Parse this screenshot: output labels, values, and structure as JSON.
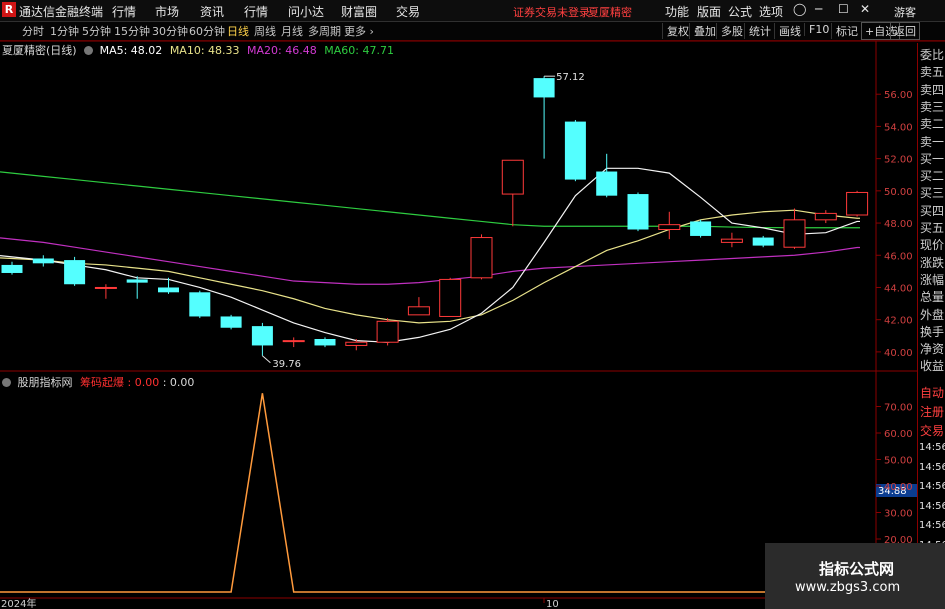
{
  "menubar": {
    "logo": "R",
    "app_title": "通达信金融终端",
    "items": [
      "行情",
      "市场",
      "资讯",
      "行情",
      "问小达",
      "财富圈",
      "交易"
    ],
    "notice": "证券交易未登录",
    "account": "夏厦精密",
    "right_items": [
      "功能",
      "版面",
      "公式",
      "选项"
    ],
    "guest": "游客"
  },
  "toolbar": {
    "periods": [
      "分时",
      "1分钟",
      "5分钟",
      "15分钟",
      "30分钟",
      "60分钟",
      "日线",
      "周线",
      "月线",
      "多周期",
      "更多"
    ],
    "active_period": "日线",
    "buttons": [
      "复权",
      "叠加",
      "多股",
      "统计",
      "画线",
      "F10",
      "标记",
      "+自选",
      "返回"
    ]
  },
  "main_chart": {
    "title": "夏厦精密(日线)",
    "ma": [
      {
        "label": "MA5: 48.02",
        "color": "#ffffff"
      },
      {
        "label": "MA10: 48.33",
        "color": "#e8e28a"
      },
      {
        "label": "MA20: 46.48",
        "color": "#d43ad4"
      },
      {
        "label": "MA60: 47.71",
        "color": "#2ecc40"
      }
    ],
    "high_label": "57.12",
    "low_label": "39.76",
    "y_ticks": [
      "56.00",
      "54.00",
      "52.00",
      "50.00",
      "48.00",
      "46.00",
      "44.00",
      "42.00",
      "40.00"
    ]
  },
  "sub_chart": {
    "title": "股朋指标网",
    "indicator_name": "筹码起爆",
    "v1": ": 0.00",
    "v2": ": 0.00",
    "y_ticks": [
      "70.00",
      "60.00",
      "50.00",
      "40.00",
      "30.00",
      "20.00"
    ],
    "current_value": "34.88"
  },
  "x_axis": {
    "year": "2024年",
    "mark": "10"
  },
  "right_panel": {
    "labels": [
      "委比",
      "卖五",
      "卖四",
      "卖三",
      "卖二",
      "卖一",
      "买一",
      "买二",
      "买三",
      "买四",
      "买五",
      "现价",
      "涨跌",
      "涨幅",
      "总量",
      "外盘",
      "换手",
      "净资",
      "收益"
    ],
    "red_labels": [
      "自动",
      "注册",
      "交易"
    ],
    "times": [
      "14:56",
      "14:56",
      "14:56",
      "14:56",
      "14:56",
      "14:56",
      "14:56",
      "14:56"
    ]
  },
  "chart_data": {
    "type": "candlestick",
    "ylim": [
      39,
      58
    ],
    "candles": [
      {
        "o": 45.4,
        "c": 44.9,
        "h": 45.6,
        "l": 44.8
      },
      {
        "o": 45.8,
        "c": 45.5,
        "h": 46.0,
        "l": 45.3
      },
      {
        "o": 45.7,
        "c": 44.2,
        "h": 45.9,
        "l": 44.1
      },
      {
        "o": 44.0,
        "c": 44.0,
        "h": 44.2,
        "l": 43.3
      },
      {
        "o": 44.5,
        "c": 44.3,
        "h": 44.7,
        "l": 43.3
      },
      {
        "o": 44.0,
        "c": 43.7,
        "h": 44.6,
        "l": 43.6
      },
      {
        "o": 43.7,
        "c": 42.2,
        "h": 43.8,
        "l": 42.1
      },
      {
        "o": 42.2,
        "c": 41.5,
        "h": 42.3,
        "l": 41.4
      },
      {
        "o": 41.6,
        "c": 40.4,
        "h": 41.8,
        "l": 39.76
      },
      {
        "o": 40.7,
        "c": 40.7,
        "h": 40.9,
        "l": 40.3
      },
      {
        "o": 40.8,
        "c": 40.4,
        "h": 40.9,
        "l": 40.3
      },
      {
        "o": 40.4,
        "c": 40.6,
        "h": 40.8,
        "l": 40.1
      },
      {
        "o": 40.6,
        "c": 41.9,
        "h": 42.1,
        "l": 40.4
      },
      {
        "o": 42.3,
        "c": 42.8,
        "h": 43.4,
        "l": 42.3
      },
      {
        "o": 42.2,
        "c": 44.5,
        "h": 44.6,
        "l": 42.2
      },
      {
        "o": 44.6,
        "c": 47.1,
        "h": 47.3,
        "l": 44.5
      },
      {
        "o": 49.8,
        "c": 51.9,
        "h": 51.9,
        "l": 47.8
      },
      {
        "o": 57.0,
        "c": 55.8,
        "h": 57.12,
        "l": 52.0
      },
      {
        "o": 54.3,
        "c": 50.7,
        "h": 54.4,
        "l": 50.6
      },
      {
        "o": 51.2,
        "c": 49.7,
        "h": 52.3,
        "l": 49.6
      },
      {
        "o": 49.8,
        "c": 47.6,
        "h": 49.9,
        "l": 47.5
      },
      {
        "o": 47.6,
        "c": 47.9,
        "h": 48.7,
        "l": 47.0
      },
      {
        "o": 48.1,
        "c": 47.2,
        "h": 48.2,
        "l": 47.1
      },
      {
        "o": 46.8,
        "c": 47.0,
        "h": 47.4,
        "l": 46.5
      },
      {
        "o": 47.1,
        "c": 46.6,
        "h": 47.2,
        "l": 46.5
      },
      {
        "o": 46.5,
        "c": 48.2,
        "h": 48.9,
        "l": 46.4
      },
      {
        "o": 48.2,
        "c": 48.6,
        "h": 48.8,
        "l": 48.0
      },
      {
        "o": 48.5,
        "c": 49.9,
        "h": 50.0,
        "l": 48.4
      }
    ],
    "ma5": [
      45.9,
      45.7,
      45.4,
      45.1,
      44.6,
      44.5,
      44.0,
      43.4,
      42.6,
      41.8,
      41.2,
      40.7,
      40.6,
      40.9,
      41.4,
      42.4,
      44.0,
      46.8,
      49.7,
      51.4,
      51.4,
      51.1,
      49.6,
      48.0,
      47.7,
      47.3,
      47.4,
      48.1
    ],
    "ma10": [
      45.8,
      45.7,
      45.5,
      45.4,
      45.2,
      45.0,
      44.6,
      44.2,
      43.8,
      43.3,
      42.7,
      42.3,
      42.0,
      41.8,
      41.9,
      42.3,
      43.2,
      44.3,
      45.3,
      46.3,
      46.9,
      47.6,
      48.2,
      48.5,
      48.7,
      48.8,
      48.5,
      48.3
    ],
    "ma20": [
      47.0,
      46.8,
      46.5,
      46.2,
      45.9,
      45.6,
      45.3,
      45.0,
      44.7,
      44.4,
      44.3,
      44.2,
      44.2,
      44.3,
      44.5,
      44.7,
      45.0,
      45.2,
      45.3,
      45.4,
      45.5,
      45.6,
      45.7,
      45.8,
      45.9,
      46.0,
      46.2,
      46.48
    ],
    "ma60": [
      51.1,
      50.9,
      50.7,
      50.5,
      50.3,
      50.1,
      49.9,
      49.7,
      49.5,
      49.3,
      49.1,
      48.9,
      48.7,
      48.5,
      48.3,
      48.1,
      47.9,
      47.8,
      47.8,
      47.8,
      47.8,
      47.8,
      47.8,
      47.75,
      47.72,
      47.71,
      47.71,
      47.71
    ],
    "indicator": {
      "ylim": [
        0,
        80
      ],
      "values": [
        0,
        0,
        0,
        0,
        0,
        0,
        0,
        0,
        75,
        0,
        0,
        0,
        0,
        0,
        0,
        0,
        0,
        0,
        0,
        0,
        0,
        0,
        0,
        0,
        0,
        0,
        0,
        0
      ]
    }
  }
}
